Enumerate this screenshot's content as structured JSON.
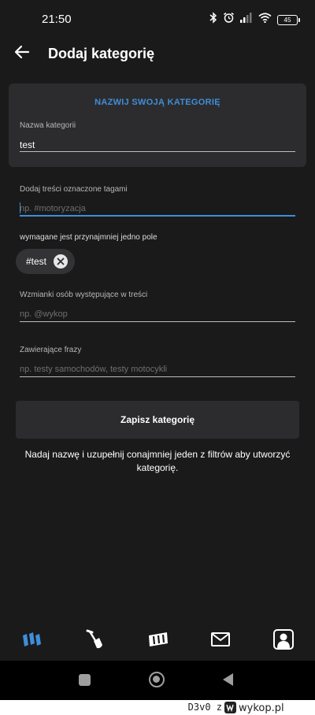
{
  "status_bar": {
    "time": "21:50",
    "battery": "45",
    "icons": [
      "bluetooth-icon",
      "alarm-icon",
      "signal-icon",
      "wifi-icon",
      "battery-icon"
    ]
  },
  "header": {
    "title": "Dodaj kategorię",
    "back_icon": "arrow-left-icon"
  },
  "name_card": {
    "heading": "NAZWIJ SWOJĄ KATEGORIĘ",
    "label": "Nazwa kategorii",
    "value": "test"
  },
  "tags_field": {
    "label": "Dodaj treści oznaczone tagami",
    "placeholder": "np. #motoryzacja",
    "helper": "wymagane jest przynajmniej jedno pole",
    "chips": [
      {
        "label": "#test"
      }
    ]
  },
  "mentions_field": {
    "label": "Wzmianki osób występujące w treści",
    "placeholder": "np. @wykop"
  },
  "phrases_field": {
    "label": "Zawierające frazy",
    "placeholder": "np. testy samochodów, testy motocykli"
  },
  "actions": {
    "save_label": "Zapisz kategorię",
    "info": "Nadaj nazwę i uzupełnij conajmniej jeden z filtrów aby utworzyć kategorię."
  },
  "bottom_nav": {
    "items": [
      "home-icon",
      "shovel-icon",
      "mikroblog-icon",
      "mail-icon",
      "profile-icon"
    ],
    "active": "home-icon",
    "accent": "#3f8ed8"
  },
  "watermark": {
    "user": "D3v0 z",
    "logo": "wykop.pl"
  },
  "colors": {
    "background": "#1a1a1b",
    "card": "#2c2c2e",
    "accent": "#3f8ed8"
  }
}
